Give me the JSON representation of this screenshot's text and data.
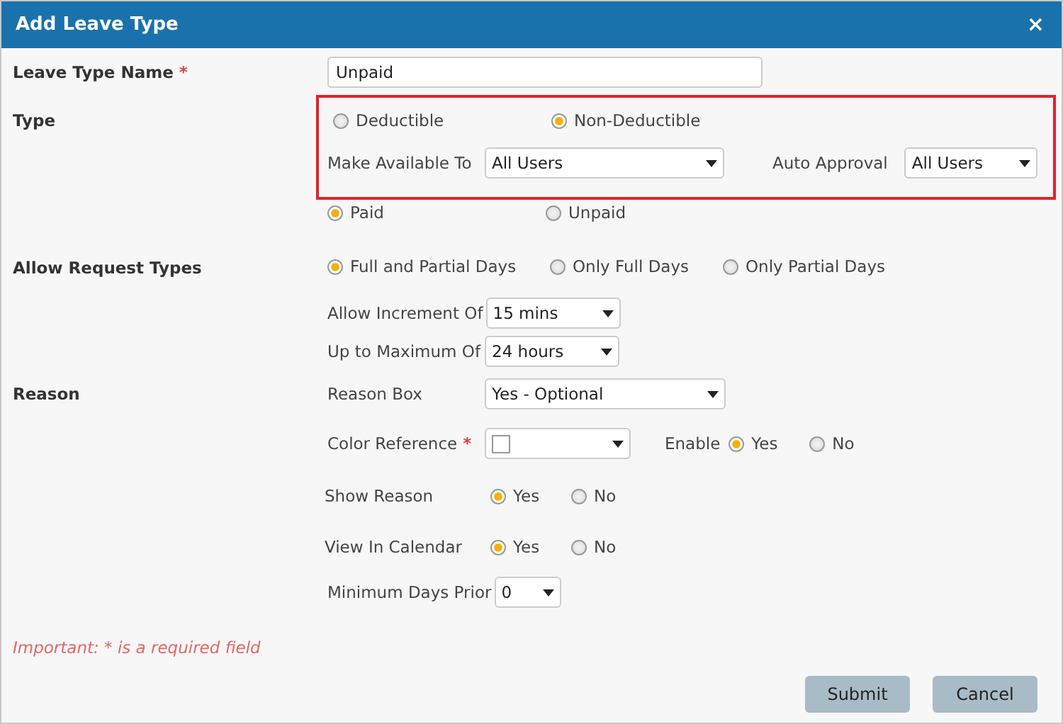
{
  "dialog": {
    "title": "Add Leave Type",
    "close": "×"
  },
  "rows": [
    {
      "kind": "text_input",
      "label": "Leave Type Name",
      "required_mark": "*",
      "value": "Unpaid"
    },
    {
      "kind": "highlight_group",
      "label": "Type",
      "highlighted": true,
      "options": [
        {
          "label": "Deductible",
          "selected": false
        },
        {
          "label": "Non-Deductible",
          "selected": true
        }
      ],
      "fields": [
        {
          "label": "Make Available To",
          "value": "All Users"
        },
        {
          "label": "Auto Approval",
          "value": "All Users"
        }
      ]
    },
    {
      "kind": "radios",
      "options": [
        {
          "label": "Paid",
          "selected": true
        },
        {
          "label": "Unpaid",
          "selected": false
        }
      ]
    },
    {
      "kind": "radios",
      "label": "Allow Request Types",
      "options": [
        {
          "label": "Full and Partial Days",
          "selected": true
        },
        {
          "label": "Only Full Days",
          "selected": false
        },
        {
          "label": "Only Partial Days",
          "selected": false
        }
      ]
    },
    {
      "kind": "select",
      "sublabel": "Allow Increment Of",
      "value": "15 mins"
    },
    {
      "kind": "select",
      "sublabel": "Up to Maximum Of",
      "value": "24 hours"
    },
    {
      "kind": "select",
      "label": "Reason",
      "sublabel": "Reason Box",
      "value": "Yes - Optional"
    },
    {
      "kind": "color",
      "sublabel": "Color Reference",
      "required_mark": "*",
      "color": "#ffffff",
      "extra_label": "Enable",
      "options": [
        {
          "label": "Yes",
          "selected": true
        },
        {
          "label": "No",
          "selected": false
        }
      ]
    },
    {
      "kind": "sub_radios",
      "sublabel": "Show Reason",
      "options": [
        {
          "label": "Yes",
          "selected": true
        },
        {
          "label": "No",
          "selected": false
        }
      ]
    },
    {
      "kind": "sub_radios",
      "sublabel": "View In Calendar",
      "options": [
        {
          "label": "Yes",
          "selected": true
        },
        {
          "label": "No",
          "selected": false
        }
      ]
    },
    {
      "kind": "select",
      "sublabel": "Minimum Days Prior",
      "value": "0"
    }
  ],
  "note": "Important: * is a required field",
  "buttons": [
    {
      "label": "Submit"
    },
    {
      "label": "Cancel"
    }
  ]
}
